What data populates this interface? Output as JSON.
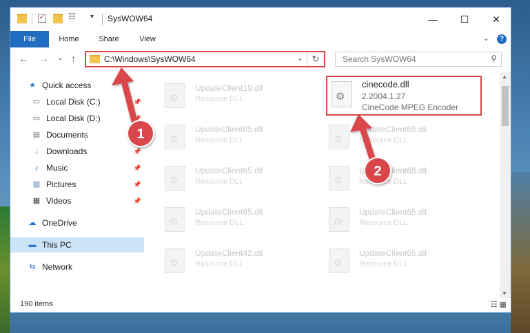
{
  "window": {
    "title": "SysWOW64",
    "controls": {
      "minimize": "—",
      "maximize": "☐",
      "close": "✕"
    }
  },
  "ribbon": {
    "tabs": [
      "File",
      "Home",
      "Share",
      "View"
    ],
    "expand_glyph": "⌄",
    "help_glyph": "?"
  },
  "address": {
    "path": "C:\\Windows\\SysWOW64",
    "dropdown_glyph": "⌄",
    "refresh_glyph": "↻",
    "back_glyph": "←",
    "forward_glyph": "→",
    "recent_glyph": "⌄",
    "up_glyph": "↑"
  },
  "search": {
    "placeholder": "Search SysWOW64",
    "icon_glyph": "⚲"
  },
  "sidebar": {
    "items": [
      {
        "label": "Quick access",
        "icon": "★",
        "pinned": false
      },
      {
        "label": "Local Disk (C:)",
        "icon": "▭",
        "pinned": true
      },
      {
        "label": "Local Disk (D:)",
        "icon": "▭",
        "pinned": true
      },
      {
        "label": "Documents",
        "icon": "▤",
        "pinned": true
      },
      {
        "label": "Downloads",
        "icon": "↓",
        "pinned": true
      },
      {
        "label": "Music",
        "icon": "♪",
        "pinned": true
      },
      {
        "label": "Pictures",
        "icon": "▨",
        "pinned": true
      },
      {
        "label": "Videos",
        "icon": "▦",
        "pinned": true
      },
      {
        "label": "OneDrive",
        "icon": "☁",
        "pinned": false
      },
      {
        "label": "This PC",
        "icon": "▬",
        "pinned": false
      },
      {
        "label": "Network",
        "icon": "⇆",
        "pinned": false
      }
    ],
    "pin_glyph": "📌"
  },
  "files": [
    {
      "name": "UpdateClient19.dll",
      "type": "Resource DLL"
    },
    {
      "name": "UpdateClient65.dll",
      "type": "Resource DLL"
    },
    {
      "name": "UpdateClient65.dll",
      "type": "Resource DLL"
    },
    {
      "name": "UpdateClient65.dll",
      "type": "Resource DLL"
    },
    {
      "name": "UpdateClient42.dll",
      "type": "Resource DLL"
    },
    {
      "name": "UpdateClient65.dll",
      "type": "Resource DLL"
    },
    {
      "name": "UpdateClient65.dll",
      "type": "Resource DLL"
    },
    {
      "name": "UpdateClient63.dll",
      "type": "Resource DLL"
    },
    {
      "name": "UpdateClient65.dll",
      "type": "Resource DLL"
    },
    {
      "name": "UpdateClient65.dll",
      "type": "Resource DLL"
    }
  ],
  "highlighted_file": {
    "name": "cinecode.dll",
    "version": "2.2004.1.27",
    "description": "CineCode MPEG Encoder"
  },
  "statusbar": {
    "item_count": "190 items",
    "view_icons": "☷ ▦"
  },
  "annotations": {
    "badge_1": "1",
    "badge_2": "2",
    "color": "#d9464c"
  }
}
